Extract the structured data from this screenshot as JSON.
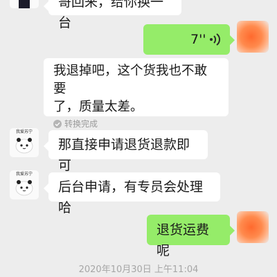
{
  "messages": {
    "top_partial": "哥回来，给你换一台",
    "voice": {
      "duration": "7''"
    },
    "transcript": {
      "line1": "我退掉吧，这个货我也不敢要",
      "line2": "了，质量太差。",
      "status": "转换完成"
    },
    "reply1": {
      "text": "那直接申请退货退款即可",
      "avatar_tag": "我爱苏宁"
    },
    "reply2": {
      "text": "后台申请，有专员会处理哈",
      "avatar_tag": "我爱苏宁"
    },
    "outgoing2": "退货运费呢"
  },
  "timestamp": "2020年10月30日 上午11:04",
  "colors": {
    "background": "#ededed",
    "outgoing_bubble": "#95ec69",
    "incoming_bubble": "#ffffff"
  }
}
